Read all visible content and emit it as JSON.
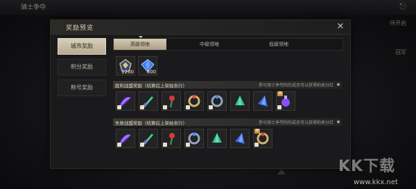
{
  "background": {
    "title": "骑士争夺",
    "right_text_1": "待开启",
    "right_text_2": "冠军"
  },
  "watermark": {
    "logo": "KK下载",
    "url": "www.kkx.net"
  },
  "modal": {
    "title": "奖励预览",
    "close_label": "✕"
  },
  "sidebar": {
    "items": [
      {
        "label": "城市奖励",
        "active": true
      },
      {
        "label": "积分奖励",
        "active": false
      },
      {
        "label": "称号奖励",
        "active": false
      }
    ]
  },
  "tabs": [
    {
      "label": "高级领地",
      "active": true
    },
    {
      "label": "中级领地",
      "active": false
    },
    {
      "label": "低级领地",
      "active": false
    }
  ],
  "top_items": [
    {
      "icon": "gold-crest-icon",
      "count": "1200"
    },
    {
      "icon": "blue-crystal-icon",
      "count": "800"
    }
  ],
  "victory_section": {
    "title": "胜利战盟奖励（结算后上架拍卖行）",
    "note": "参与骑士争夺的的成员可以获得拍卖分红",
    "items": [
      {
        "icon": "purple-scroll-icon"
      },
      {
        "icon": "green-blade-icon"
      },
      {
        "icon": "red-rose-icon"
      },
      {
        "icon": "gold-ring-icon"
      },
      {
        "icon": "blue-ring-icon"
      },
      {
        "icon": "green-shard-icon"
      },
      {
        "icon": "blue-shard-icon"
      },
      {
        "icon": "purple-potion-icon",
        "tag": "绑"
      }
    ]
  },
  "defeat_section": {
    "title": "失败战盟奖励（结算后上架拍卖行）",
    "note": "参与骑士争夺的的成员可以获得拍卖分红",
    "items": [
      {
        "icon": "purple-scroll-icon"
      },
      {
        "icon": "green-blade-icon"
      },
      {
        "icon": "red-rose-icon"
      },
      {
        "icon": "blue-ring-icon"
      },
      {
        "icon": "green-shard-icon"
      },
      {
        "icon": "blue-shard-icon"
      },
      {
        "icon": "gold-ring-icon",
        "tag": "绑"
      }
    ]
  },
  "colors": {
    "gold": "#d4cab2",
    "purple": "#8a4cff",
    "green": "#3fd08a",
    "blue": "#4a8cff",
    "red": "#d23a3a"
  }
}
